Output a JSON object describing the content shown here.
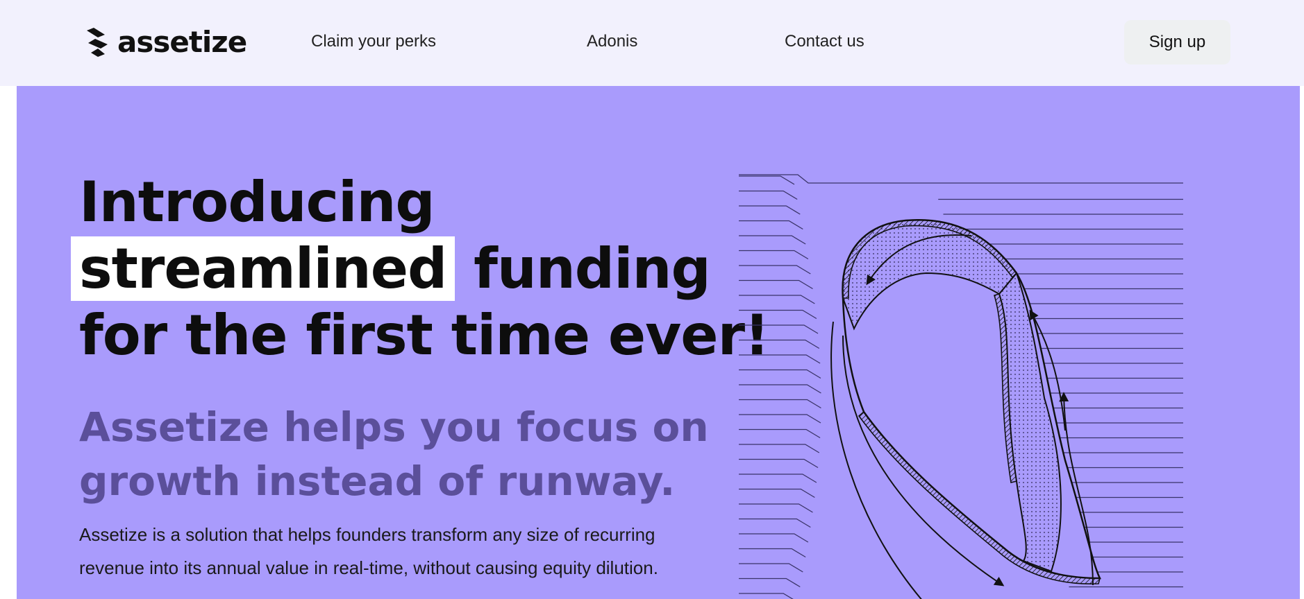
{
  "nav": {
    "logo_text": "assetize",
    "links": [
      "Claim your perks",
      "Adonis",
      "Contact us"
    ],
    "signup_label": "Sign up"
  },
  "hero": {
    "headline_line1": "Introducing",
    "headline_highlight": "streamlined",
    "headline_line2_rest": " funding",
    "headline_line3": "for the first time ever!",
    "subhead_line1": "Assetize helps you focus on",
    "subhead_line2": "growth instead of runway.",
    "body": "Assetize is a solution that helps founders transform any size of recurring revenue into its annual value in real-time, without causing equity dilution."
  },
  "colors": {
    "hero_bg": "#a99bfc",
    "nav_bg": "#f2f1fd",
    "subhead": "#5b4f9a",
    "highlight_bg": "#ffffff"
  },
  "icons": {
    "logo": "assetize-logo-icon",
    "illustration": "loop-ribbon-illustration"
  }
}
